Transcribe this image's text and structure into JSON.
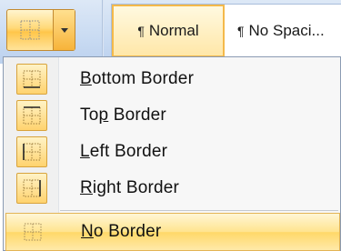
{
  "ribbon": {
    "styles": [
      {
        "mark": "¶",
        "label": "Normal"
      },
      {
        "mark": "¶",
        "label": "No Spaci..."
      }
    ]
  },
  "menu": {
    "items": [
      {
        "prefix": "",
        "accel": "B",
        "suffix": "ottom Border",
        "icon": "bottom-border-icon"
      },
      {
        "prefix": "To",
        "accel": "p",
        "suffix": " Border",
        "icon": "top-border-icon"
      },
      {
        "prefix": "",
        "accel": "L",
        "suffix": "eft Border",
        "icon": "left-border-icon"
      },
      {
        "prefix": "",
        "accel": "R",
        "suffix": "ight Border",
        "icon": "right-border-icon"
      },
      {
        "prefix": "",
        "accel": "N",
        "suffix": "o Border",
        "icon": "no-border-icon"
      }
    ]
  },
  "colors": {
    "hover": "#ffd868",
    "accent_border": "#e3b456",
    "ribbon": "#c9dbf2"
  }
}
